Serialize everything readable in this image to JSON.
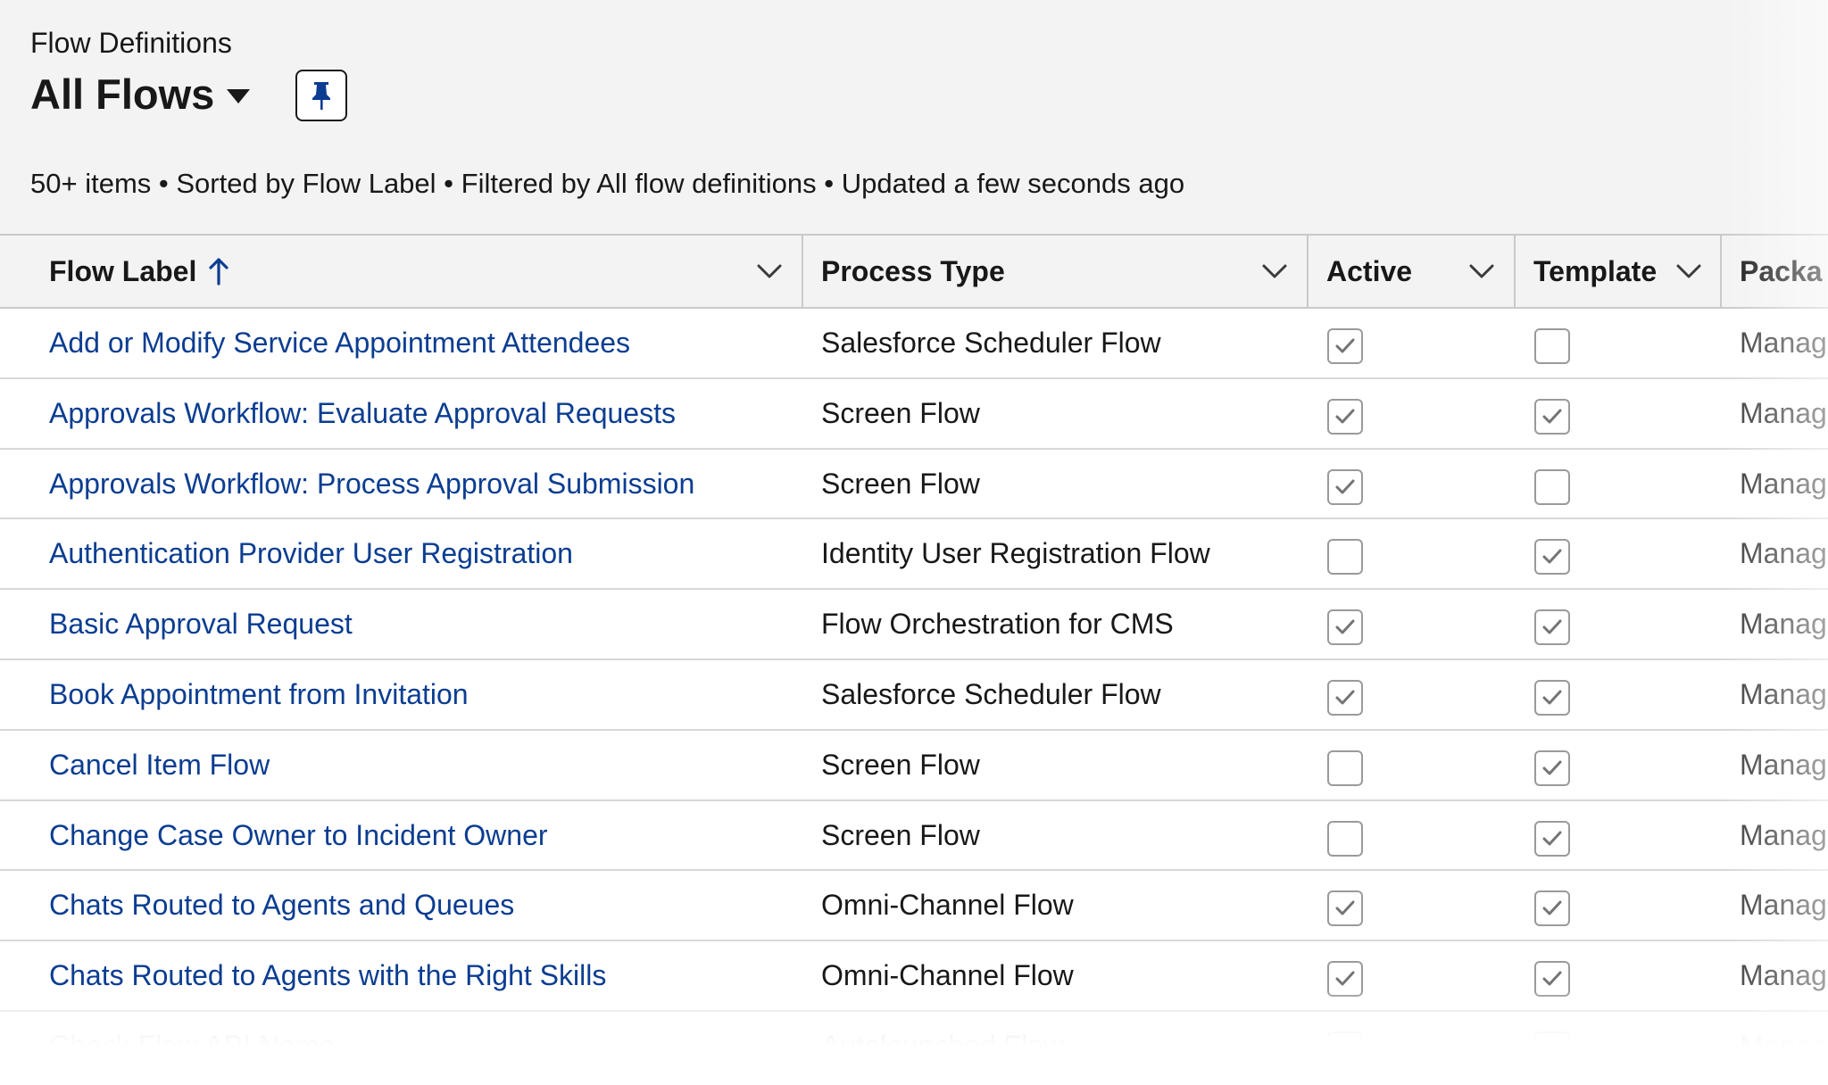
{
  "header": {
    "eyebrow": "Flow Definitions",
    "title": "All Flows",
    "dropdown_icon": "caret-down-icon",
    "pin_icon": "pin-icon",
    "meta": "50+ items • Sorted by Flow Label • Filtered by All flow definitions • Updated a few seconds ago"
  },
  "table": {
    "columns": [
      {
        "label": "Flow Label",
        "sort_icon": "arrow-up-icon",
        "menu_icon": "chevron-down-icon"
      },
      {
        "label": "Process Type",
        "menu_icon": "chevron-down-icon"
      },
      {
        "label": "Active",
        "menu_icon": "chevron-down-icon"
      },
      {
        "label": "Template",
        "menu_icon": "chevron-down-icon"
      },
      {
        "label": "Packa"
      }
    ],
    "rows": [
      {
        "label": "Add or Modify Service Appointment Attendees",
        "type": "Salesforce Scheduler Flow",
        "active": true,
        "template": false,
        "package": "Manag"
      },
      {
        "label": "Approvals Workflow: Evaluate Approval Requests",
        "type": "Screen Flow",
        "active": true,
        "template": true,
        "package": "Manag"
      },
      {
        "label": "Approvals Workflow: Process Approval Submission",
        "type": "Screen Flow",
        "active": true,
        "template": false,
        "package": "Manag"
      },
      {
        "label": "Authentication Provider User Registration",
        "type": "Identity User Registration Flow",
        "active": false,
        "template": true,
        "package": "Manag"
      },
      {
        "label": "Basic Approval Request",
        "type": "Flow Orchestration for CMS",
        "active": true,
        "template": true,
        "package": "Manag"
      },
      {
        "label": "Book Appointment from Invitation",
        "type": "Salesforce Scheduler Flow",
        "active": true,
        "template": true,
        "package": "Manag"
      },
      {
        "label": "Cancel Item Flow",
        "type": "Screen Flow",
        "active": false,
        "template": true,
        "package": "Manag"
      },
      {
        "label": "Change Case Owner to Incident Owner",
        "type": "Screen Flow",
        "active": false,
        "template": true,
        "package": "Manag"
      },
      {
        "label": "Chats Routed to Agents and Queues",
        "type": "Omni-Channel Flow",
        "active": true,
        "template": true,
        "package": "Manag"
      },
      {
        "label": "Chats Routed to Agents with the Right Skills",
        "type": "Omni-Channel Flow",
        "active": true,
        "template": true,
        "package": "Manag"
      },
      {
        "label": "Check Flow API Name",
        "type": "Autolaunched Flow",
        "active": true,
        "template": false,
        "package": "Manag"
      }
    ]
  },
  "colors": {
    "link": "#0b3d91",
    "header_bg": "#f3f3f3",
    "border": "#c9c9c9",
    "text": "#181818"
  }
}
